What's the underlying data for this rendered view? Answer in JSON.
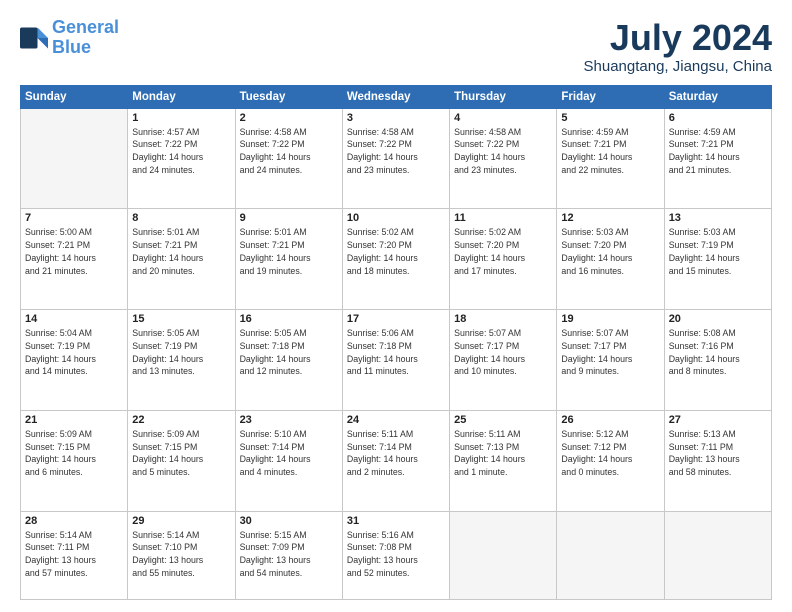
{
  "header": {
    "logo_line1": "General",
    "logo_line2": "Blue",
    "month": "July 2024",
    "location": "Shuangtang, Jiangsu, China"
  },
  "weekdays": [
    "Sunday",
    "Monday",
    "Tuesday",
    "Wednesday",
    "Thursday",
    "Friday",
    "Saturday"
  ],
  "weeks": [
    [
      {
        "day": "",
        "info": ""
      },
      {
        "day": "1",
        "info": "Sunrise: 4:57 AM\nSunset: 7:22 PM\nDaylight: 14 hours\nand 24 minutes."
      },
      {
        "day": "2",
        "info": "Sunrise: 4:58 AM\nSunset: 7:22 PM\nDaylight: 14 hours\nand 24 minutes."
      },
      {
        "day": "3",
        "info": "Sunrise: 4:58 AM\nSunset: 7:22 PM\nDaylight: 14 hours\nand 23 minutes."
      },
      {
        "day": "4",
        "info": "Sunrise: 4:58 AM\nSunset: 7:22 PM\nDaylight: 14 hours\nand 23 minutes."
      },
      {
        "day": "5",
        "info": "Sunrise: 4:59 AM\nSunset: 7:21 PM\nDaylight: 14 hours\nand 22 minutes."
      },
      {
        "day": "6",
        "info": "Sunrise: 4:59 AM\nSunset: 7:21 PM\nDaylight: 14 hours\nand 21 minutes."
      }
    ],
    [
      {
        "day": "7",
        "info": "Sunrise: 5:00 AM\nSunset: 7:21 PM\nDaylight: 14 hours\nand 21 minutes."
      },
      {
        "day": "8",
        "info": "Sunrise: 5:01 AM\nSunset: 7:21 PM\nDaylight: 14 hours\nand 20 minutes."
      },
      {
        "day": "9",
        "info": "Sunrise: 5:01 AM\nSunset: 7:21 PM\nDaylight: 14 hours\nand 19 minutes."
      },
      {
        "day": "10",
        "info": "Sunrise: 5:02 AM\nSunset: 7:20 PM\nDaylight: 14 hours\nand 18 minutes."
      },
      {
        "day": "11",
        "info": "Sunrise: 5:02 AM\nSunset: 7:20 PM\nDaylight: 14 hours\nand 17 minutes."
      },
      {
        "day": "12",
        "info": "Sunrise: 5:03 AM\nSunset: 7:20 PM\nDaylight: 14 hours\nand 16 minutes."
      },
      {
        "day": "13",
        "info": "Sunrise: 5:03 AM\nSunset: 7:19 PM\nDaylight: 14 hours\nand 15 minutes."
      }
    ],
    [
      {
        "day": "14",
        "info": "Sunrise: 5:04 AM\nSunset: 7:19 PM\nDaylight: 14 hours\nand 14 minutes."
      },
      {
        "day": "15",
        "info": "Sunrise: 5:05 AM\nSunset: 7:19 PM\nDaylight: 14 hours\nand 13 minutes."
      },
      {
        "day": "16",
        "info": "Sunrise: 5:05 AM\nSunset: 7:18 PM\nDaylight: 14 hours\nand 12 minutes."
      },
      {
        "day": "17",
        "info": "Sunrise: 5:06 AM\nSunset: 7:18 PM\nDaylight: 14 hours\nand 11 minutes."
      },
      {
        "day": "18",
        "info": "Sunrise: 5:07 AM\nSunset: 7:17 PM\nDaylight: 14 hours\nand 10 minutes."
      },
      {
        "day": "19",
        "info": "Sunrise: 5:07 AM\nSunset: 7:17 PM\nDaylight: 14 hours\nand 9 minutes."
      },
      {
        "day": "20",
        "info": "Sunrise: 5:08 AM\nSunset: 7:16 PM\nDaylight: 14 hours\nand 8 minutes."
      }
    ],
    [
      {
        "day": "21",
        "info": "Sunrise: 5:09 AM\nSunset: 7:15 PM\nDaylight: 14 hours\nand 6 minutes."
      },
      {
        "day": "22",
        "info": "Sunrise: 5:09 AM\nSunset: 7:15 PM\nDaylight: 14 hours\nand 5 minutes."
      },
      {
        "day": "23",
        "info": "Sunrise: 5:10 AM\nSunset: 7:14 PM\nDaylight: 14 hours\nand 4 minutes."
      },
      {
        "day": "24",
        "info": "Sunrise: 5:11 AM\nSunset: 7:14 PM\nDaylight: 14 hours\nand 2 minutes."
      },
      {
        "day": "25",
        "info": "Sunrise: 5:11 AM\nSunset: 7:13 PM\nDaylight: 14 hours\nand 1 minute."
      },
      {
        "day": "26",
        "info": "Sunrise: 5:12 AM\nSunset: 7:12 PM\nDaylight: 14 hours\nand 0 minutes."
      },
      {
        "day": "27",
        "info": "Sunrise: 5:13 AM\nSunset: 7:11 PM\nDaylight: 13 hours\nand 58 minutes."
      }
    ],
    [
      {
        "day": "28",
        "info": "Sunrise: 5:14 AM\nSunset: 7:11 PM\nDaylight: 13 hours\nand 57 minutes."
      },
      {
        "day": "29",
        "info": "Sunrise: 5:14 AM\nSunset: 7:10 PM\nDaylight: 13 hours\nand 55 minutes."
      },
      {
        "day": "30",
        "info": "Sunrise: 5:15 AM\nSunset: 7:09 PM\nDaylight: 13 hours\nand 54 minutes."
      },
      {
        "day": "31",
        "info": "Sunrise: 5:16 AM\nSunset: 7:08 PM\nDaylight: 13 hours\nand 52 minutes."
      },
      {
        "day": "",
        "info": ""
      },
      {
        "day": "",
        "info": ""
      },
      {
        "day": "",
        "info": ""
      }
    ]
  ]
}
